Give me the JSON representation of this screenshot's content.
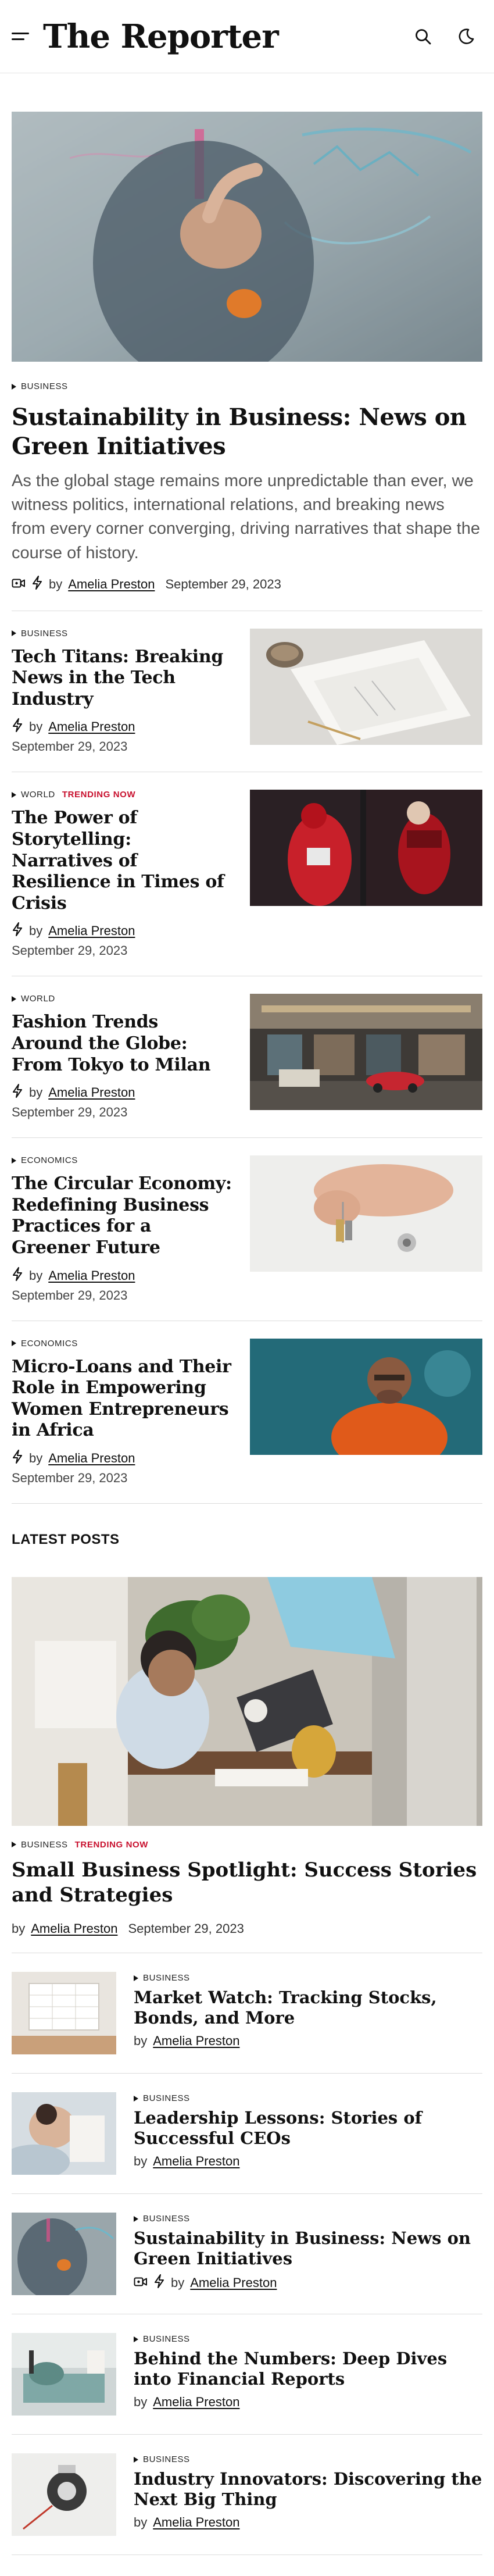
{
  "header": {
    "logo": "The Reporter",
    "menu_icon": "hamburger-icon",
    "search_icon": "search-icon",
    "theme_icon": "moon-icon"
  },
  "colors": {
    "trending": "#c8102e",
    "text": "#111111",
    "muted": "#555555"
  },
  "hero": {
    "category": "BUSINESS",
    "title": "Sustainability in Business: News on Green Initiatives",
    "excerpt": "As the global stage remains more unpredictable than ever, we witness politics, international relations, and breaking news from every corner converging, driving narratives that shape the course of history.",
    "by": "by",
    "author": "Amelia Preston",
    "date": "September 29, 2023",
    "icons": [
      "video-icon",
      "bolt-icon"
    ]
  },
  "list": [
    {
      "category": "BUSINESS",
      "trending": "",
      "title": "Tech Titans: Breaking News in the Tech Industry",
      "by": "by",
      "author": "Amelia Preston",
      "date": "September 29, 2023"
    },
    {
      "category": "WORLD",
      "trending": "TRENDING NOW",
      "title": "The Power of Storytelling: Narratives of Resilience in Times of Crisis",
      "by": "by",
      "author": "Amelia Preston",
      "date": "September 29, 2023"
    },
    {
      "category": "WORLD",
      "trending": "",
      "title": "Fashion Trends Around the Globe: From Tokyo to Milan",
      "by": "by",
      "author": "Amelia Preston",
      "date": "September 29, 2023"
    },
    {
      "category": "ECONOMICS",
      "trending": "",
      "title": "The Circular Economy: Redefining Business Practices for a Greener Future",
      "by": "by",
      "author": "Amelia Preston",
      "date": "September 29, 2023"
    },
    {
      "category": "ECONOMICS",
      "trending": "",
      "title": "Micro-Loans and Their Role in Empowering Women Entrepreneurs in Africa",
      "by": "by",
      "author": "Amelia Preston",
      "date": "September 29, 2023"
    }
  ],
  "latest": {
    "section_title": "LATEST POSTS",
    "feature": {
      "category": "BUSINESS",
      "trending": "TRENDING NOW",
      "title": "Small Business Spotlight: Success Stories and Strategies",
      "by": "by",
      "author": "Amelia Preston",
      "date": "September 29, 2023"
    },
    "items": [
      {
        "category": "BUSINESS",
        "title": "Market Watch: Tracking Stocks, Bonds, and More",
        "by": "by",
        "author": "Amelia Preston"
      },
      {
        "category": "BUSINESS",
        "title": "Leadership Lessons: Stories of Successful CEOs",
        "by": "by",
        "author": "Amelia Preston"
      },
      {
        "category": "BUSINESS",
        "title": "Sustainability in Business: News on Green Initiatives",
        "by": "by",
        "author": "Amelia Preston"
      },
      {
        "category": "BUSINESS",
        "title": "Behind the Numbers: Deep Dives into Financial Reports",
        "by": "by",
        "author": "Amelia Preston"
      },
      {
        "category": "BUSINESS",
        "title": "Industry Innovators: Discovering the Next Big Thing",
        "by": "by",
        "author": "Amelia Preston"
      }
    ]
  }
}
